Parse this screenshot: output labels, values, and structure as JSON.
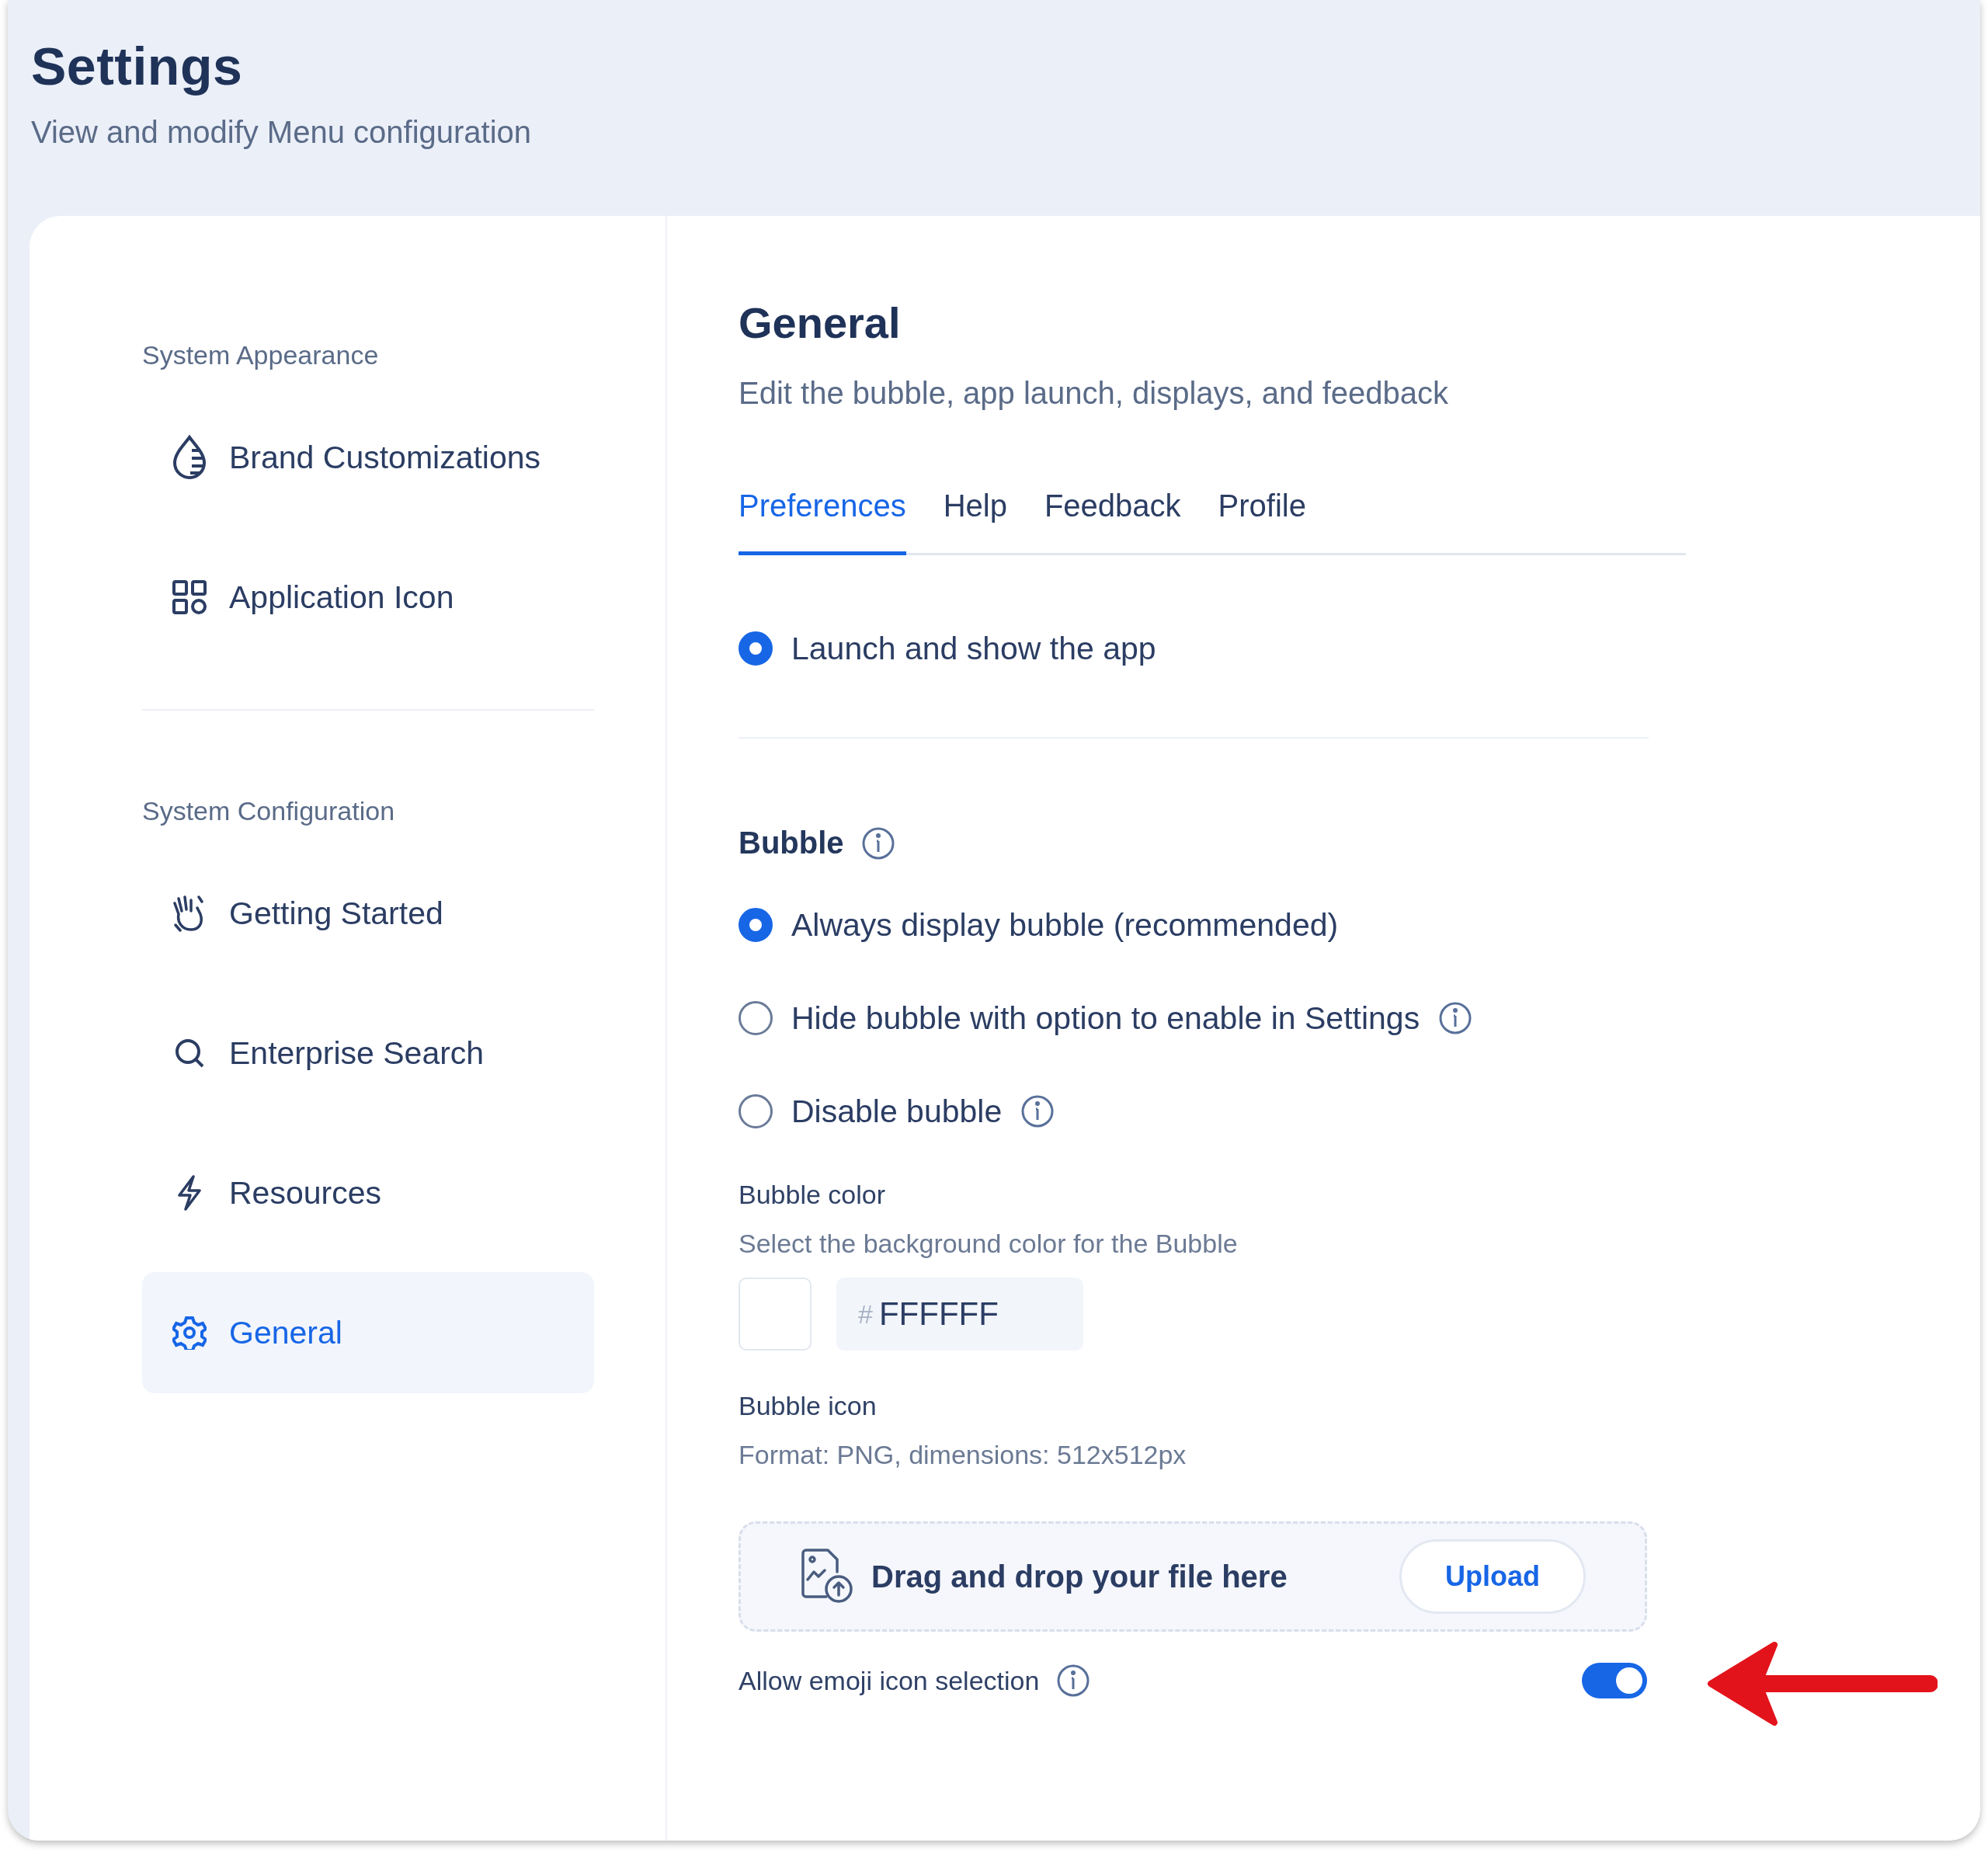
{
  "header": {
    "title": "Settings",
    "subtitle": "View and modify Menu configuration"
  },
  "sidebar": {
    "sections": [
      {
        "label": "System Appearance",
        "items": [
          {
            "label": "Brand Customizations",
            "kind": "drop",
            "selected": false
          },
          {
            "label": "Application Icon",
            "kind": "grid",
            "selected": false
          }
        ]
      },
      {
        "label": "System Configuration",
        "items": [
          {
            "label": "Getting Started",
            "kind": "hand",
            "selected": false
          },
          {
            "label": "Enterprise Search",
            "kind": "search",
            "selected": false
          },
          {
            "label": "Resources",
            "kind": "bolt",
            "selected": false
          },
          {
            "label": "General",
            "kind": "gear",
            "selected": true
          }
        ]
      }
    ]
  },
  "main": {
    "title": "General",
    "subtitle": "Edit the bubble, app launch, displays, and feedback",
    "tabs": [
      {
        "label": "Preferences",
        "selected": true
      },
      {
        "label": "Help",
        "selected": false
      },
      {
        "label": "Feedback",
        "selected": false
      },
      {
        "label": "Profile",
        "selected": false
      }
    ],
    "launch_options": [
      {
        "label": "Launch and show the app",
        "selected": true
      }
    ],
    "bubble": {
      "title": "Bubble",
      "info": true,
      "options": [
        {
          "label": "Always display bubble (recommended)",
          "selected": true,
          "info": false
        },
        {
          "label": "Hide bubble with option to enable in Settings",
          "selected": false,
          "info": true
        },
        {
          "label": "Disable bubble",
          "selected": false,
          "info": true
        }
      ],
      "color": {
        "label": "Bubble color",
        "description": "Select the background color for the Bubble",
        "prefix": "#",
        "value": "FFFFFF"
      },
      "icon": {
        "label": "Bubble icon",
        "description": "Format: PNG, dimensions: 512x512px",
        "dropzone": "Drag and drop your file here",
        "button": "Upload"
      },
      "emoji": {
        "label": "Allow emoji icon selection",
        "info": true,
        "on": true
      }
    }
  }
}
